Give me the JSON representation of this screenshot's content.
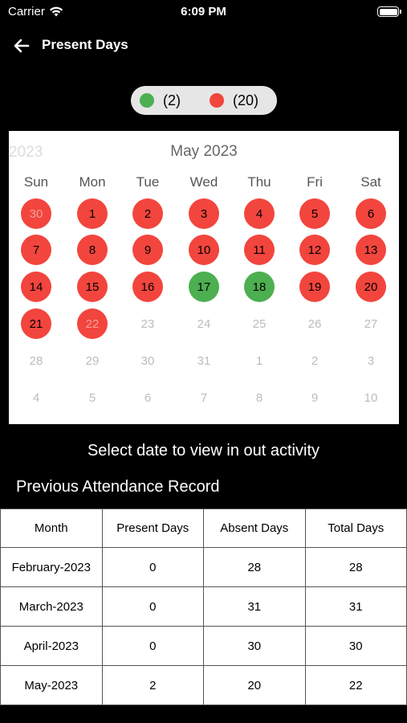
{
  "status_bar": {
    "carrier": "Carrier",
    "time": "6:09 PM"
  },
  "nav": {
    "title": "Present Days"
  },
  "legend": [
    {
      "color": "#4caf50",
      "label": "(2)"
    },
    {
      "color": "#f2453d",
      "label": "(20)"
    }
  ],
  "calendar": {
    "prev_year": "2023",
    "month_label": "May 2023",
    "weekdays": [
      "Sun",
      "Mon",
      "Tue",
      "Wed",
      "Thu",
      "Fri",
      "Sat"
    ],
    "weeks": [
      [
        {
          "d": "30",
          "s": "absent-faded"
        },
        {
          "d": "1",
          "s": "absent"
        },
        {
          "d": "2",
          "s": "absent"
        },
        {
          "d": "3",
          "s": "absent"
        },
        {
          "d": "4",
          "s": "absent"
        },
        {
          "d": "5",
          "s": "absent"
        },
        {
          "d": "6",
          "s": "absent"
        }
      ],
      [
        {
          "d": "7",
          "s": "absent"
        },
        {
          "d": "8",
          "s": "absent"
        },
        {
          "d": "9",
          "s": "absent"
        },
        {
          "d": "10",
          "s": "absent"
        },
        {
          "d": "11",
          "s": "absent"
        },
        {
          "d": "12",
          "s": "absent"
        },
        {
          "d": "13",
          "s": "absent"
        }
      ],
      [
        {
          "d": "14",
          "s": "absent"
        },
        {
          "d": "15",
          "s": "absent"
        },
        {
          "d": "16",
          "s": "absent"
        },
        {
          "d": "17",
          "s": "present"
        },
        {
          "d": "18",
          "s": "present"
        },
        {
          "d": "19",
          "s": "absent"
        },
        {
          "d": "20",
          "s": "absent"
        }
      ],
      [
        {
          "d": "21",
          "s": "absent"
        },
        {
          "d": "22",
          "s": "absent-faded"
        },
        {
          "d": "23",
          "s": "none"
        },
        {
          "d": "24",
          "s": "none"
        },
        {
          "d": "25",
          "s": "none"
        },
        {
          "d": "26",
          "s": "none"
        },
        {
          "d": "27",
          "s": "none"
        }
      ],
      [
        {
          "d": "28",
          "s": "none"
        },
        {
          "d": "29",
          "s": "none"
        },
        {
          "d": "30",
          "s": "none"
        },
        {
          "d": "31",
          "s": "none"
        },
        {
          "d": "1",
          "s": "none"
        },
        {
          "d": "2",
          "s": "none"
        },
        {
          "d": "3",
          "s": "none"
        }
      ],
      [
        {
          "d": "4",
          "s": "none"
        },
        {
          "d": "5",
          "s": "none"
        },
        {
          "d": "6",
          "s": "none"
        },
        {
          "d": "7",
          "s": "none"
        },
        {
          "d": "8",
          "s": "none"
        },
        {
          "d": "9",
          "s": "none"
        },
        {
          "d": "10",
          "s": "none"
        }
      ]
    ]
  },
  "hint": "Select date to view in out activity",
  "records": {
    "title": "Previous Attendance Record",
    "headers": [
      "Month",
      "Present Days",
      "Absent Days",
      "Total Days"
    ],
    "rows": [
      [
        "February-2023",
        "0",
        "28",
        "28"
      ],
      [
        "March-2023",
        "0",
        "31",
        "31"
      ],
      [
        "April-2023",
        "0",
        "30",
        "30"
      ],
      [
        "May-2023",
        "2",
        "20",
        "22"
      ]
    ]
  },
  "icons": {
    "back": "arrow-left-icon",
    "wifi": "wifi-icon",
    "battery": "battery-icon"
  }
}
